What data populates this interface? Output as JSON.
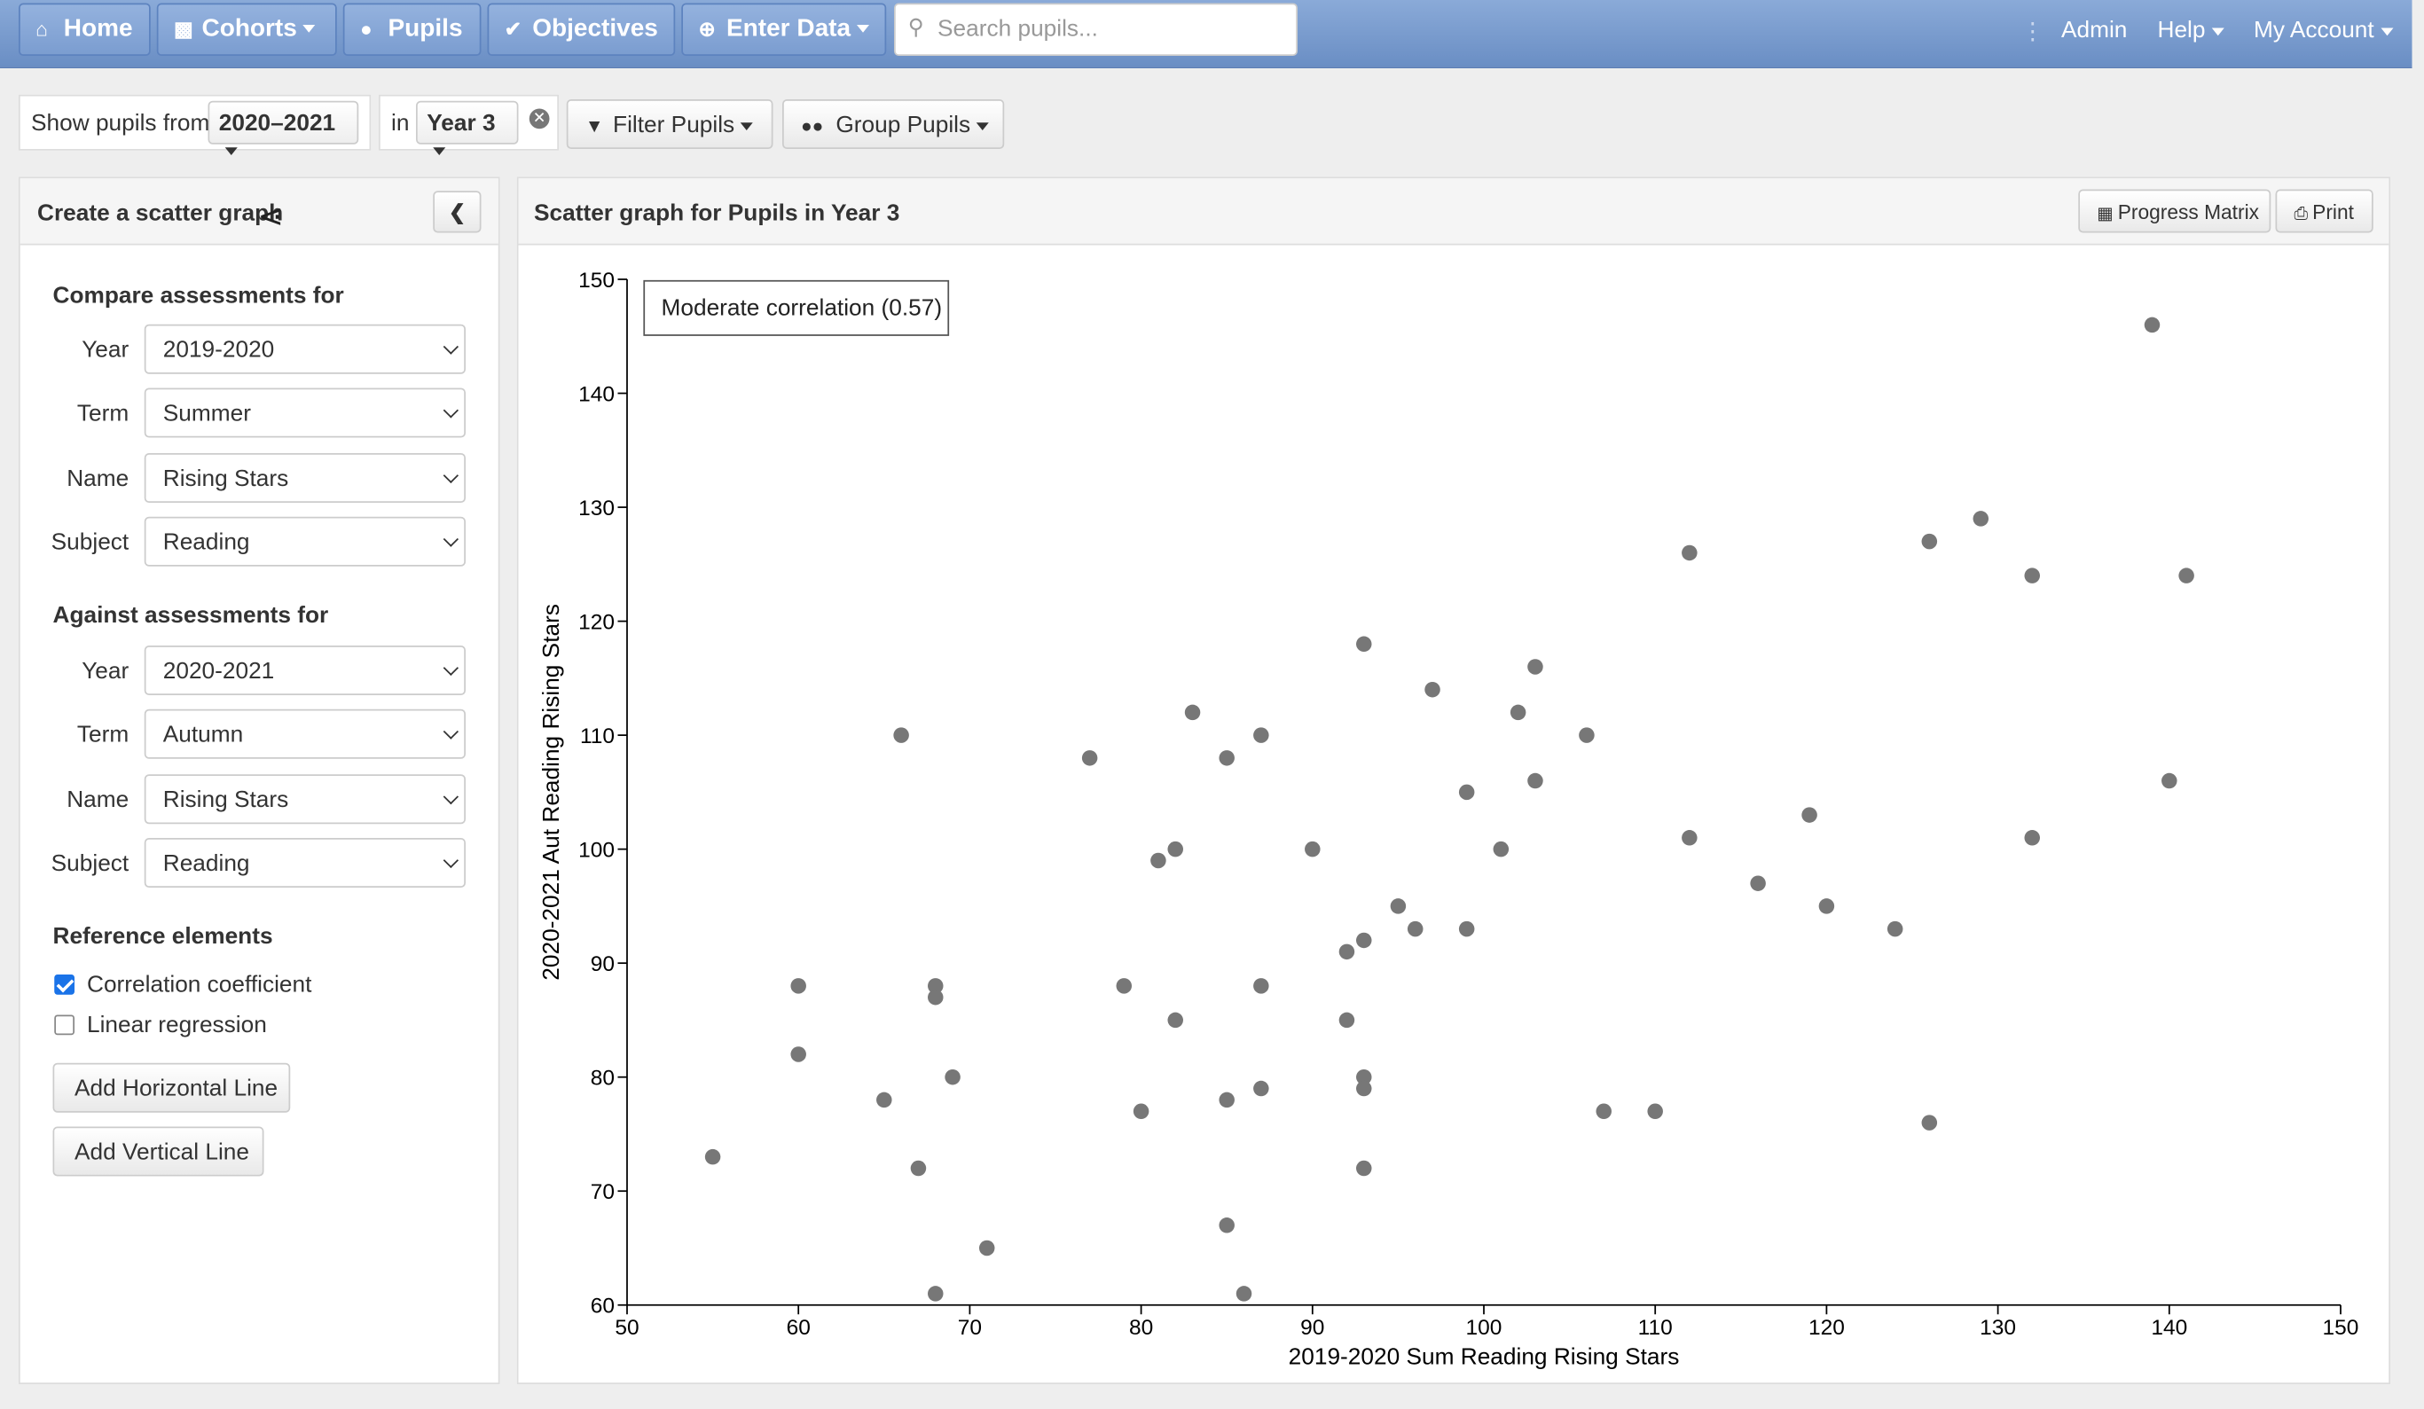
{
  "nav": {
    "home": "Home",
    "cohorts": "Cohorts",
    "pupils": "Pupils",
    "objectives": "Objectives",
    "enter_data": "Enter Data",
    "search_placeholder": "Search pupils...",
    "admin": "Admin",
    "help": "Help",
    "my_account": "My Account"
  },
  "filterbar": {
    "show_label": "Show pupils from",
    "year_range": "2020–2021",
    "in_label": "in",
    "year_group": "Year 3",
    "filter_pupils": "Filter Pupils",
    "group_pupils": "Group Pupils"
  },
  "sidebar": {
    "title": "Create a scatter graph",
    "compare_heading": "Compare assessments for",
    "against_heading": "Against assessments for",
    "compare": [
      {
        "label": "Year",
        "value": "2019-2020"
      },
      {
        "label": "Term",
        "value": "Summer"
      },
      {
        "label": "Name",
        "value": "Rising Stars"
      },
      {
        "label": "Subject",
        "value": "Reading"
      }
    ],
    "against": [
      {
        "label": "Year",
        "value": "2020-2021"
      },
      {
        "label": "Term",
        "value": "Autumn"
      },
      {
        "label": "Name",
        "value": "Rising Stars"
      },
      {
        "label": "Subject",
        "value": "Reading"
      }
    ],
    "reference_heading": "Reference elements",
    "correlation_label": "Correlation coefficient",
    "correlation_checked": true,
    "regression_label": "Linear regression",
    "regression_checked": false,
    "add_horizontal": "Add Horizontal Line",
    "add_vertical": "Add Vertical Line"
  },
  "main": {
    "title": "Scatter graph for Pupils in Year 3",
    "progress_matrix": "Progress Matrix",
    "print": "Print"
  },
  "chart_data": {
    "type": "scatter",
    "xlabel": "2019-2020 Sum Reading Rising Stars",
    "ylabel": "2020-2021 Aut Reading Rising Stars",
    "xlim": [
      50,
      150
    ],
    "ylim": [
      60,
      150
    ],
    "xticks": [
      50,
      60,
      70,
      80,
      90,
      100,
      110,
      120,
      130,
      140,
      150
    ],
    "yticks": [
      60,
      70,
      80,
      90,
      100,
      110,
      120,
      130,
      140,
      150
    ],
    "grid": false,
    "annotation": "Moderate correlation (0.57)",
    "point_color": "#777777",
    "points": [
      [
        55,
        73
      ],
      [
        60,
        88
      ],
      [
        60,
        82
      ],
      [
        65,
        78
      ],
      [
        66,
        110
      ],
      [
        67,
        72
      ],
      [
        68,
        88
      ],
      [
        68,
        87
      ],
      [
        68,
        61
      ],
      [
        69,
        80
      ],
      [
        71,
        65
      ],
      [
        77,
        108
      ],
      [
        79,
        88
      ],
      [
        80,
        77
      ],
      [
        81,
        99
      ],
      [
        82,
        100
      ],
      [
        82,
        85
      ],
      [
        83,
        112
      ],
      [
        85,
        108
      ],
      [
        85,
        78
      ],
      [
        85,
        67
      ],
      [
        86,
        61
      ],
      [
        87,
        110
      ],
      [
        87,
        88
      ],
      [
        87,
        79
      ],
      [
        90,
        100
      ],
      [
        92,
        91
      ],
      [
        92,
        85
      ],
      [
        93,
        118
      ],
      [
        93,
        92
      ],
      [
        93,
        80
      ],
      [
        93,
        79
      ],
      [
        93,
        72
      ],
      [
        95,
        95
      ],
      [
        96,
        93
      ],
      [
        97,
        114
      ],
      [
        99,
        105
      ],
      [
        99,
        93
      ],
      [
        101,
        100
      ],
      [
        102,
        112
      ],
      [
        103,
        116
      ],
      [
        103,
        106
      ],
      [
        106,
        110
      ],
      [
        107,
        77
      ],
      [
        110,
        77
      ],
      [
        112,
        126
      ],
      [
        112,
        101
      ],
      [
        116,
        97
      ],
      [
        119,
        103
      ],
      [
        120,
        95
      ],
      [
        124,
        93
      ],
      [
        126,
        127
      ],
      [
        126,
        76
      ],
      [
        129,
        129
      ],
      [
        132,
        124
      ],
      [
        132,
        101
      ],
      [
        139,
        146
      ],
      [
        140,
        106
      ],
      [
        141,
        124
      ]
    ]
  }
}
